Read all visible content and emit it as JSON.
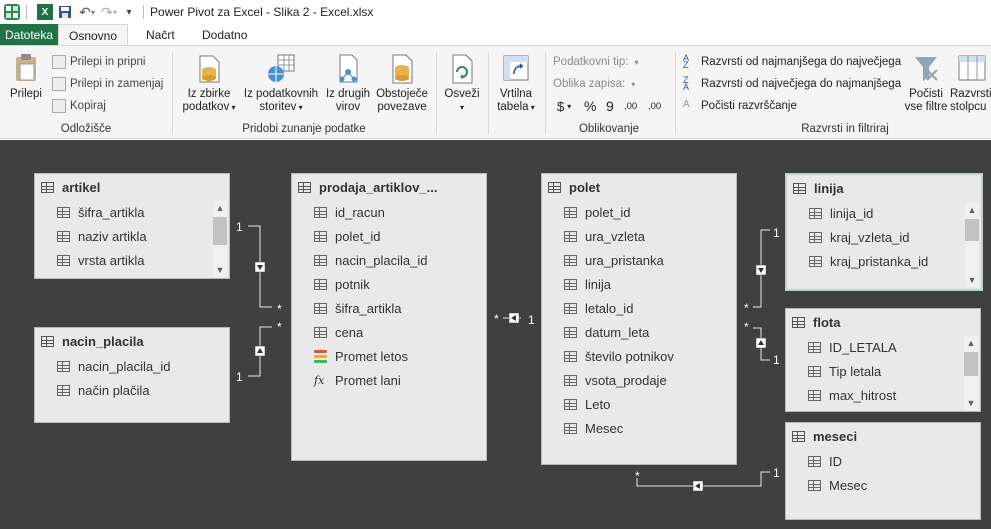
{
  "titlebar": {
    "title": "Power Pivot za Excel - Slika 2 - Excel.xlsx"
  },
  "tabs": [
    "Datoteka",
    "Osnovno",
    "Načrt",
    "Dodatno"
  ],
  "ribbon": {
    "clipboard": {
      "paste": "Prilepi",
      "paste_append": "Prilepi in pripni",
      "paste_replace": "Prilepi in zamenjaj",
      "copy": "Kopiraj",
      "label": "Odložišče"
    },
    "external": {
      "from_db_1": "Iz zbirke",
      "from_db_2": "podatkov",
      "from_service_1": "Iz podatkovnih",
      "from_service_2": "storitev",
      "from_other_1": "Iz drugih",
      "from_other_2": "virov",
      "existing_1": "Obstoječe",
      "existing_2": "povezave",
      "label": "Pridobi zunanje podatke"
    },
    "refresh": "Osveži",
    "pivot_1": "Vrtilna",
    "pivot_2": "tabela",
    "formatting": {
      "data_type": "Podatkovni tip:",
      "format": "Oblika zapisa:",
      "currency": "$",
      "percent": "%",
      "thousands": "9",
      "inc_dec": ",00",
      "dec_dec": ",00",
      "label": "Oblikovanje"
    },
    "sort": {
      "asc": "Razvrsti od najmanjšega do največjega",
      "desc": "Razvrsti od največjega do najmanjšega",
      "clear_sort": "Počisti razvrščanje",
      "clear_filters_1": "Počisti",
      "clear_filters_2": "vse filtre",
      "sort_by_col_1": "Razvrsti",
      "sort_by_col_2": "stolpcu",
      "label": "Razvrsti in filtriraj"
    }
  },
  "tables": {
    "artikel": {
      "name": "artikel",
      "fields": [
        "šifra_artikla",
        "naziv artikla",
        "vrsta artikla"
      ]
    },
    "nacin_placila": {
      "name": "nacin_placila",
      "fields": [
        "nacin_placila_id",
        "način plačila"
      ]
    },
    "prodaja": {
      "name": "prodaja_artiklov_...",
      "fields": [
        "id_racun",
        "polet_id",
        "nacin_placila_id",
        "potnik",
        "šifra_artikla",
        "cena"
      ],
      "kpi": "Promet letos",
      "measure": "Promet lani"
    },
    "polet": {
      "name": "polet",
      "fields": [
        "polet_id",
        "ura_vzleta",
        "ura_pristanka",
        "linija",
        "letalo_id",
        "datum_leta",
        "število potnikov",
        "vsota_prodaje",
        "Leto",
        "Mesec"
      ]
    },
    "linija": {
      "name": "linija",
      "fields": [
        "linija_id",
        "kraj_vzleta_id",
        "kraj_pristanka_id"
      ]
    },
    "flota": {
      "name": "flota",
      "fields": [
        "ID_LETALA",
        "Tip letala",
        "max_hitrost"
      ]
    },
    "meseci": {
      "name": "meseci",
      "fields": [
        "ID",
        "Mesec"
      ]
    }
  },
  "relationships": {
    "one": "1",
    "many": "*"
  },
  "colors": {
    "excel_green": "#217346",
    "canvas": "#404040"
  }
}
